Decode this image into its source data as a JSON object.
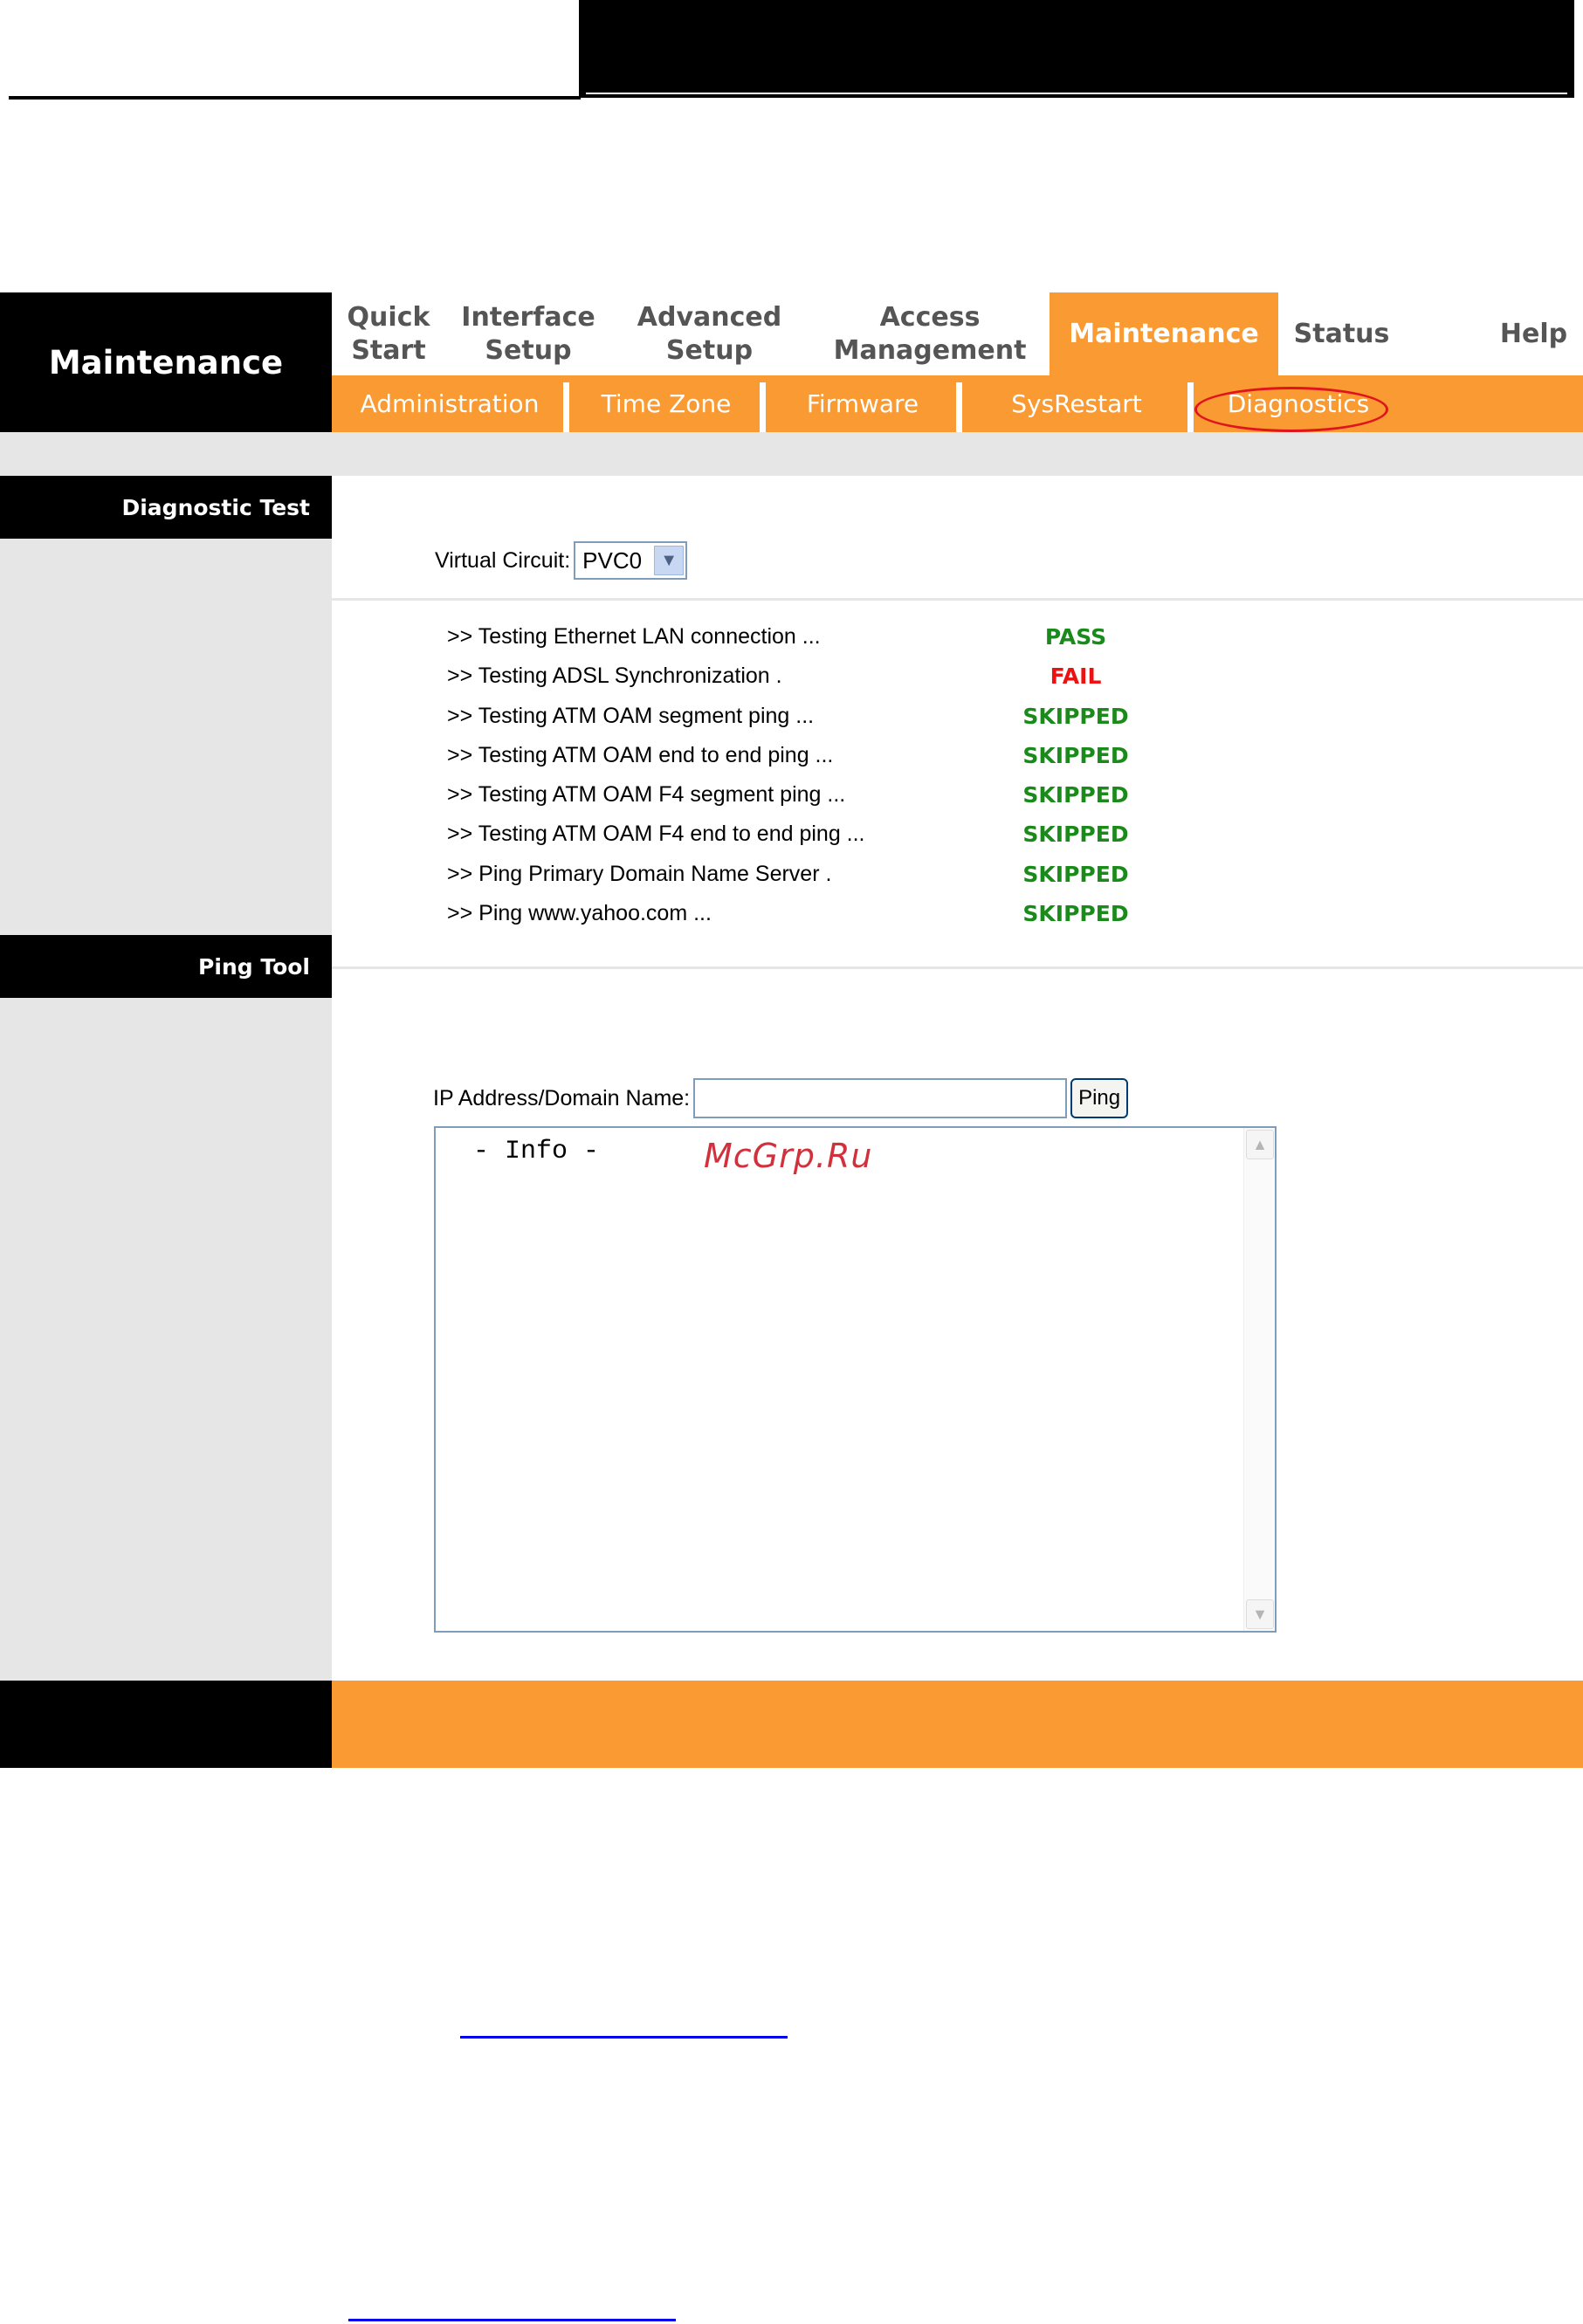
{
  "nav": {
    "brand": "Maintenance",
    "items": [
      {
        "label_line1": "Quick",
        "label_line2": "Start"
      },
      {
        "label_line1": "Interface",
        "label_line2": "Setup"
      },
      {
        "label_line1": "Advanced",
        "label_line2": "Setup"
      },
      {
        "label_line1": "Access",
        "label_line2": "Management"
      },
      {
        "label": "Maintenance",
        "active": true
      },
      {
        "label": "Status"
      },
      {
        "label": "Help"
      }
    ],
    "sub_items": [
      {
        "label": "Administration"
      },
      {
        "label": "Time Zone"
      },
      {
        "label": "Firmware"
      },
      {
        "label": "SysRestart"
      },
      {
        "label": "Diagnostics",
        "selected": true
      }
    ]
  },
  "sidebar": {
    "diagnostic_label": "Diagnostic Test",
    "ping_label": "Ping Tool"
  },
  "diagnostic": {
    "vc_label": "Virtual Circuit:",
    "vc_value": "PVC0",
    "tests": [
      {
        "name": ">> Testing Ethernet LAN connection ...",
        "result": "PASS",
        "color": "#1a8a1a"
      },
      {
        "name": ">> Testing ADSL Synchronization .",
        "result": "FAIL",
        "color": "#ee1111"
      },
      {
        "name": ">> Testing ATM OAM segment ping ...",
        "result": "SKIPPED",
        "color": "#1a8a1a"
      },
      {
        "name": ">> Testing ATM OAM end to end ping ...",
        "result": "SKIPPED",
        "color": "#1a8a1a"
      },
      {
        "name": ">> Testing ATM OAM F4 segment ping ...",
        "result": "SKIPPED",
        "color": "#1a8a1a"
      },
      {
        "name": ">> Testing ATM OAM F4 end to end ping ...",
        "result": "SKIPPED",
        "color": "#1a8a1a"
      },
      {
        "name": ">> Ping Primary Domain Name Server .",
        "result": "SKIPPED",
        "color": "#1a8a1a"
      },
      {
        "name": ">> Ping www.yahoo.com ...",
        "result": "SKIPPED",
        "color": "#1a8a1a"
      }
    ]
  },
  "ping": {
    "label": "IP Address/Domain Name:",
    "input_value": "",
    "button_label": "Ping",
    "info_text": " - Info -"
  },
  "watermark": "McGrp.Ru",
  "colors": {
    "accent": "#f99a33",
    "sidebar_bg": "#e6e6e6"
  }
}
